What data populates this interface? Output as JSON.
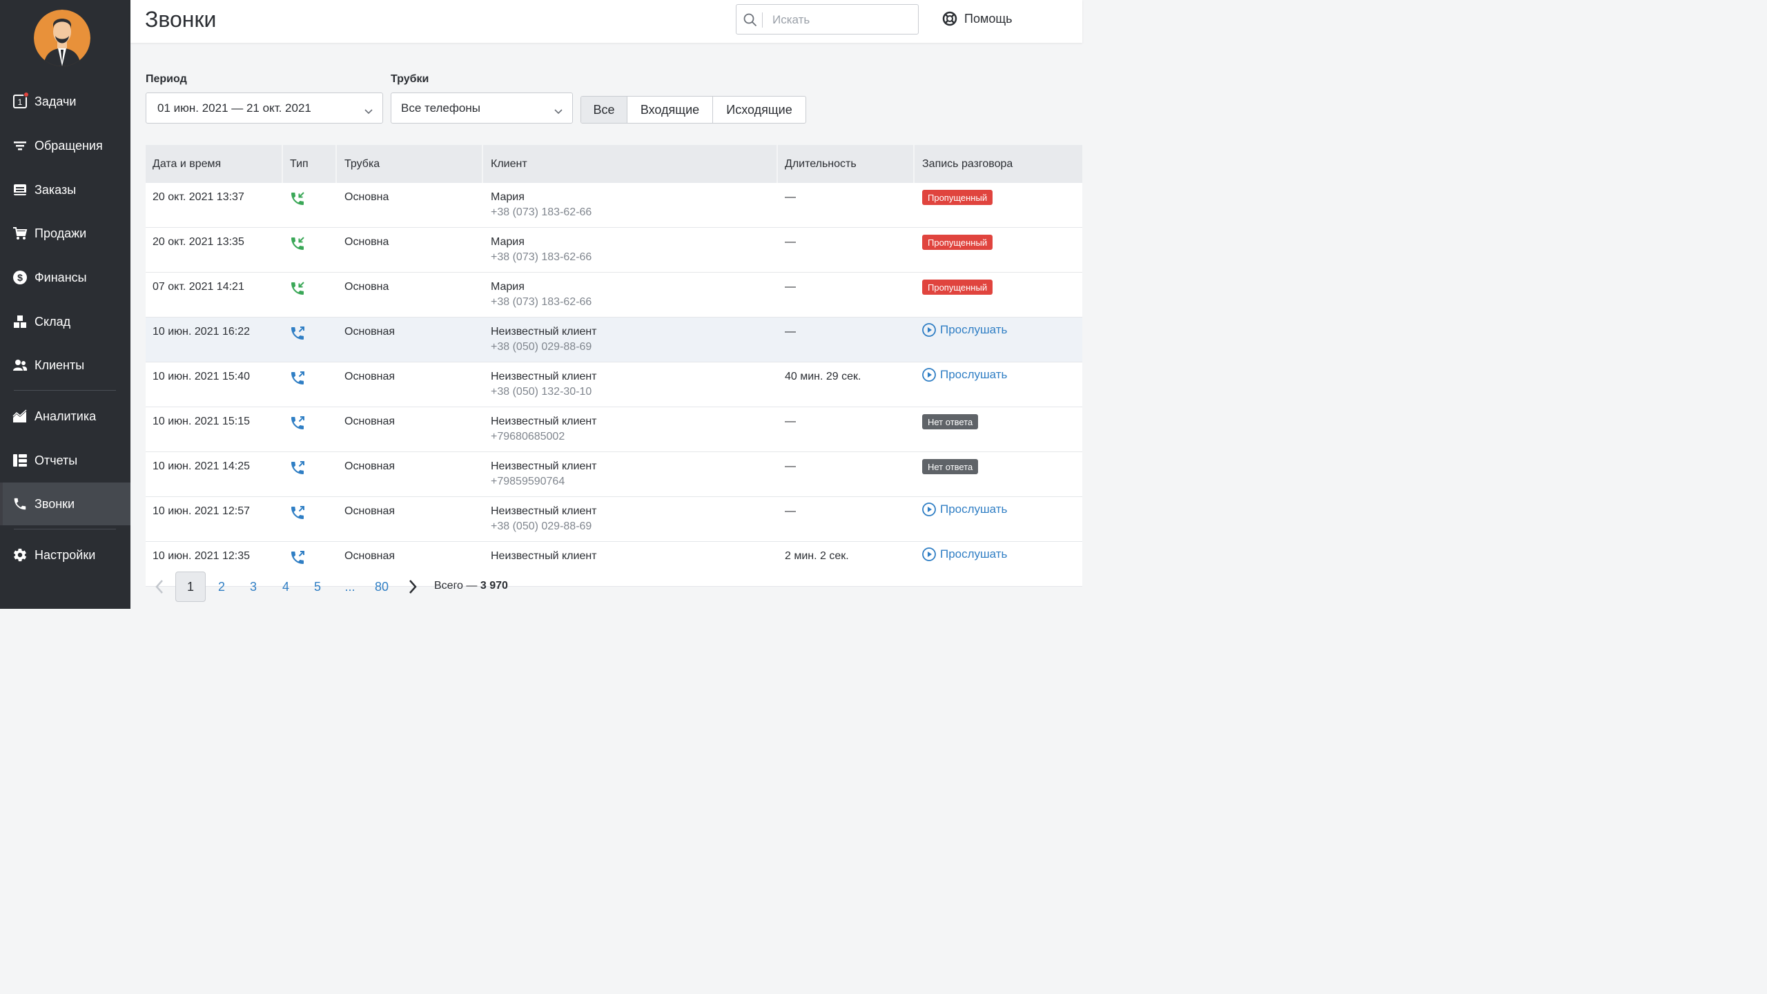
{
  "header": {
    "title": "Звонки",
    "search_placeholder": "Искать",
    "help_label": "Помощь"
  },
  "sidebar": {
    "items": [
      {
        "label": "Задачи",
        "icon": "tasks-icon"
      },
      {
        "label": "Обращения",
        "icon": "filter-icon"
      },
      {
        "label": "Заказы",
        "icon": "orders-icon"
      },
      {
        "label": "Продажи",
        "icon": "cart-icon"
      },
      {
        "label": "Финансы",
        "icon": "dollar-icon"
      },
      {
        "label": "Склад",
        "icon": "warehouse-icon"
      },
      {
        "label": "Клиенты",
        "icon": "clients-icon"
      },
      {
        "label": "Аналитика",
        "icon": "analytics-icon"
      },
      {
        "label": "Отчеты",
        "icon": "reports-icon"
      },
      {
        "label": "Звонки",
        "icon": "phone-icon"
      },
      {
        "label": "Настройки",
        "icon": "gear-icon"
      }
    ],
    "tasks_badge_count": "1",
    "active": "Звонки"
  },
  "filters": {
    "period_label": "Период",
    "period_value": "01 июн. 2021 — 21 окт. 2021",
    "phones_label": "Трубки",
    "phones_value": "Все телефоны",
    "segments": [
      "Все",
      "Входящие",
      "Исходящие"
    ],
    "active_segment": "Все"
  },
  "table": {
    "columns": [
      "Дата и время",
      "Тип",
      "Трубка",
      "Клиент",
      "Длительность",
      "Запись разговора"
    ],
    "rows": [
      {
        "datetime": "20 окт. 2021 13:37",
        "type": "incoming",
        "line": "Основна",
        "client": "Мария",
        "phone": "+38 (073) 183-62-66",
        "duration": "—",
        "record": {
          "kind": "tag-missed",
          "text": "Пропущенный"
        }
      },
      {
        "datetime": "20 окт. 2021 13:35",
        "type": "incoming",
        "line": "Основна",
        "client": "Мария",
        "phone": "+38 (073) 183-62-66",
        "duration": "—",
        "record": {
          "kind": "tag-missed",
          "text": "Пропущенный"
        }
      },
      {
        "datetime": "07 окт. 2021 14:21",
        "type": "incoming",
        "line": "Основна",
        "client": "Мария",
        "phone": "+38 (073) 183-62-66",
        "duration": "—",
        "record": {
          "kind": "tag-missed",
          "text": "Пропущенный"
        }
      },
      {
        "datetime": "10 июн. 2021 16:22",
        "type": "outgoing",
        "line": "Основная",
        "client": "Неизвестный клиент",
        "phone": "+38 (050) 029-88-69",
        "duration": "—",
        "record": {
          "kind": "listen",
          "text": "Прослушать"
        }
      },
      {
        "datetime": "10 июн. 2021 15:40",
        "type": "outgoing",
        "line": "Основная",
        "client": "Неизвестный клиент",
        "phone": "+38 (050) 132-30-10",
        "duration": "40 мин. 29 сек.",
        "record": {
          "kind": "listen",
          "text": "Прослушать"
        }
      },
      {
        "datetime": "10 июн. 2021 15:15",
        "type": "outgoing",
        "line": "Основная",
        "client": "Неизвестный клиент",
        "phone": "+79680685002",
        "duration": "—",
        "record": {
          "kind": "tag-noanswer",
          "text": "Нет ответа"
        }
      },
      {
        "datetime": "10 июн. 2021 14:25",
        "type": "outgoing",
        "line": "Основная",
        "client": "Неизвестный клиент",
        "phone": "+79859590764",
        "duration": "—",
        "record": {
          "kind": "tag-noanswer",
          "text": "Нет ответа"
        }
      },
      {
        "datetime": "10 июн. 2021 12:57",
        "type": "outgoing",
        "line": "Основная",
        "client": "Неизвестный клиент",
        "phone": "+38 (050) 029-88-69",
        "duration": "—",
        "record": {
          "kind": "listen",
          "text": "Прослушать"
        }
      },
      {
        "datetime": "10 июн. 2021 12:35",
        "type": "outgoing",
        "line": "Основная",
        "client": "Неизвестный клиент",
        "phone": "",
        "duration": "2 мин. 2 сек.",
        "record": {
          "kind": "listen",
          "text": "Прослушать"
        }
      }
    ]
  },
  "pagination": {
    "pages": [
      "1",
      "2",
      "3",
      "4",
      "5",
      "...",
      "80"
    ],
    "current": "1",
    "total_label": "Всего —",
    "total_value": "3 970"
  },
  "colors": {
    "sidebar_bg": "#2b2e33",
    "incoming_green": "#3aa757",
    "outgoing_blue": "#2f7ec4",
    "missed_red": "#e0443e",
    "noanswer_gray": "#5f6368",
    "link_blue": "#2f7ec4"
  }
}
